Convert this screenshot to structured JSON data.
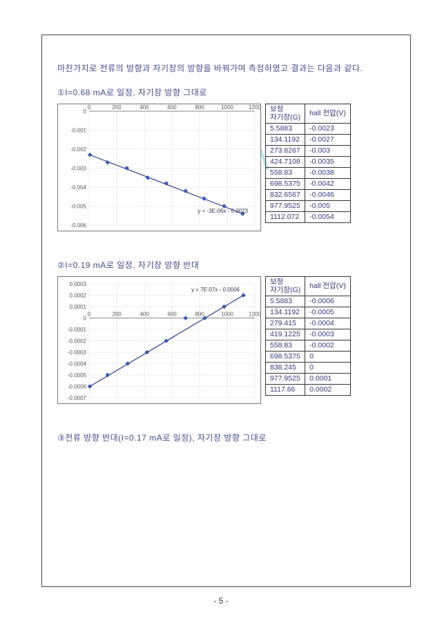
{
  "intro": "마찬가지로   전류의 방향과 자기장의 방향을 바꿔가며 측정하였고 결과는 다음과 같다.",
  "watermark": "미리보기",
  "page_number": "- 5 -",
  "section1": {
    "heading_num": "①",
    "heading_text": "I=0.68 mA로 일정, 자기장 방향 그대로",
    "table_h1_top": "보정",
    "table_h1_bot": "자기장(G)",
    "table_h2": "hall 전압(V)",
    "rows": [
      {
        "g": "5.5883",
        "v": "-0.0023"
      },
      {
        "g": "134.1192",
        "v": "-0.0027"
      },
      {
        "g": "273.8267",
        "v": "-0.003"
      },
      {
        "g": "424.7108",
        "v": "-0.0035"
      },
      {
        "g": "558.83",
        "v": "-0.0038"
      },
      {
        "g": "698.5375",
        "v": "-0.0042"
      },
      {
        "g": "832.6567",
        "v": "-0.0046"
      },
      {
        "g": "977.9525",
        "v": "-0.005"
      },
      {
        "g": "1112.072",
        "v": "-0.0054"
      }
    ]
  },
  "section2": {
    "heading_num": "②",
    "heading_text": "I=0.19 mA로 일정, 자기장 방향 반대",
    "table_h1_top": "보정",
    "table_h1_bot": "자기장(G)",
    "table_h2": "hall 전압(V)",
    "rows": [
      {
        "g": "5.5883",
        "v": "-0.0006"
      },
      {
        "g": "134.1192",
        "v": "-0.0005"
      },
      {
        "g": "279.415",
        "v": "-0.0004"
      },
      {
        "g": "419.1225",
        "v": "-0.0003"
      },
      {
        "g": "558.83",
        "v": "-0.0002"
      },
      {
        "g": "698.5375",
        "v": "0"
      },
      {
        "g": "838.245",
        "v": "0"
      },
      {
        "g": "977.9525",
        "v": "0.0001"
      },
      {
        "g": "1117.66",
        "v": "0.0002"
      }
    ]
  },
  "section3": {
    "heading_num": "③",
    "heading_text": "전류 방향 반대(I=0.17 mA로 일정), 자기장 방향 그대로"
  },
  "chart_data": [
    {
      "type": "scatter",
      "x": [
        5.59,
        134.12,
        273.83,
        424.71,
        558.83,
        698.54,
        832.66,
        977.95,
        1112.07
      ],
      "y": [
        -0.0023,
        -0.0027,
        -0.003,
        -0.0035,
        -0.0038,
        -0.0042,
        -0.0046,
        -0.005,
        -0.0054
      ],
      "trendline": "y = -3E-06x - 0.0023",
      "xlim": [
        0,
        1200
      ],
      "ylim": [
        -0.006,
        0
      ],
      "xticks": [
        0,
        200,
        400,
        600,
        800,
        1000,
        1200
      ],
      "yticks": [
        0,
        -0.001,
        -0.002,
        -0.003,
        -0.004,
        -0.005,
        -0.006
      ]
    },
    {
      "type": "scatter",
      "x": [
        5.59,
        134.12,
        279.42,
        419.12,
        558.83,
        698.54,
        838.25,
        977.95,
        1117.66
      ],
      "y": [
        -0.0006,
        -0.0005,
        -0.0004,
        -0.0003,
        -0.0002,
        0,
        0,
        0.0001,
        0.0002
      ],
      "trendline": "y = 7E-07x - 0.0006",
      "xlim": [
        0,
        1200
      ],
      "ylim": [
        -0.0007,
        0.0003
      ],
      "xticks": [
        0,
        200,
        400,
        600,
        800,
        1000,
        1200
      ],
      "yticks": [
        0.0003,
        0.0002,
        0.0001,
        0,
        -0.0001,
        -0.0002,
        -0.0003,
        -0.0004,
        -0.0005,
        -0.0006,
        -0.0007
      ]
    }
  ]
}
